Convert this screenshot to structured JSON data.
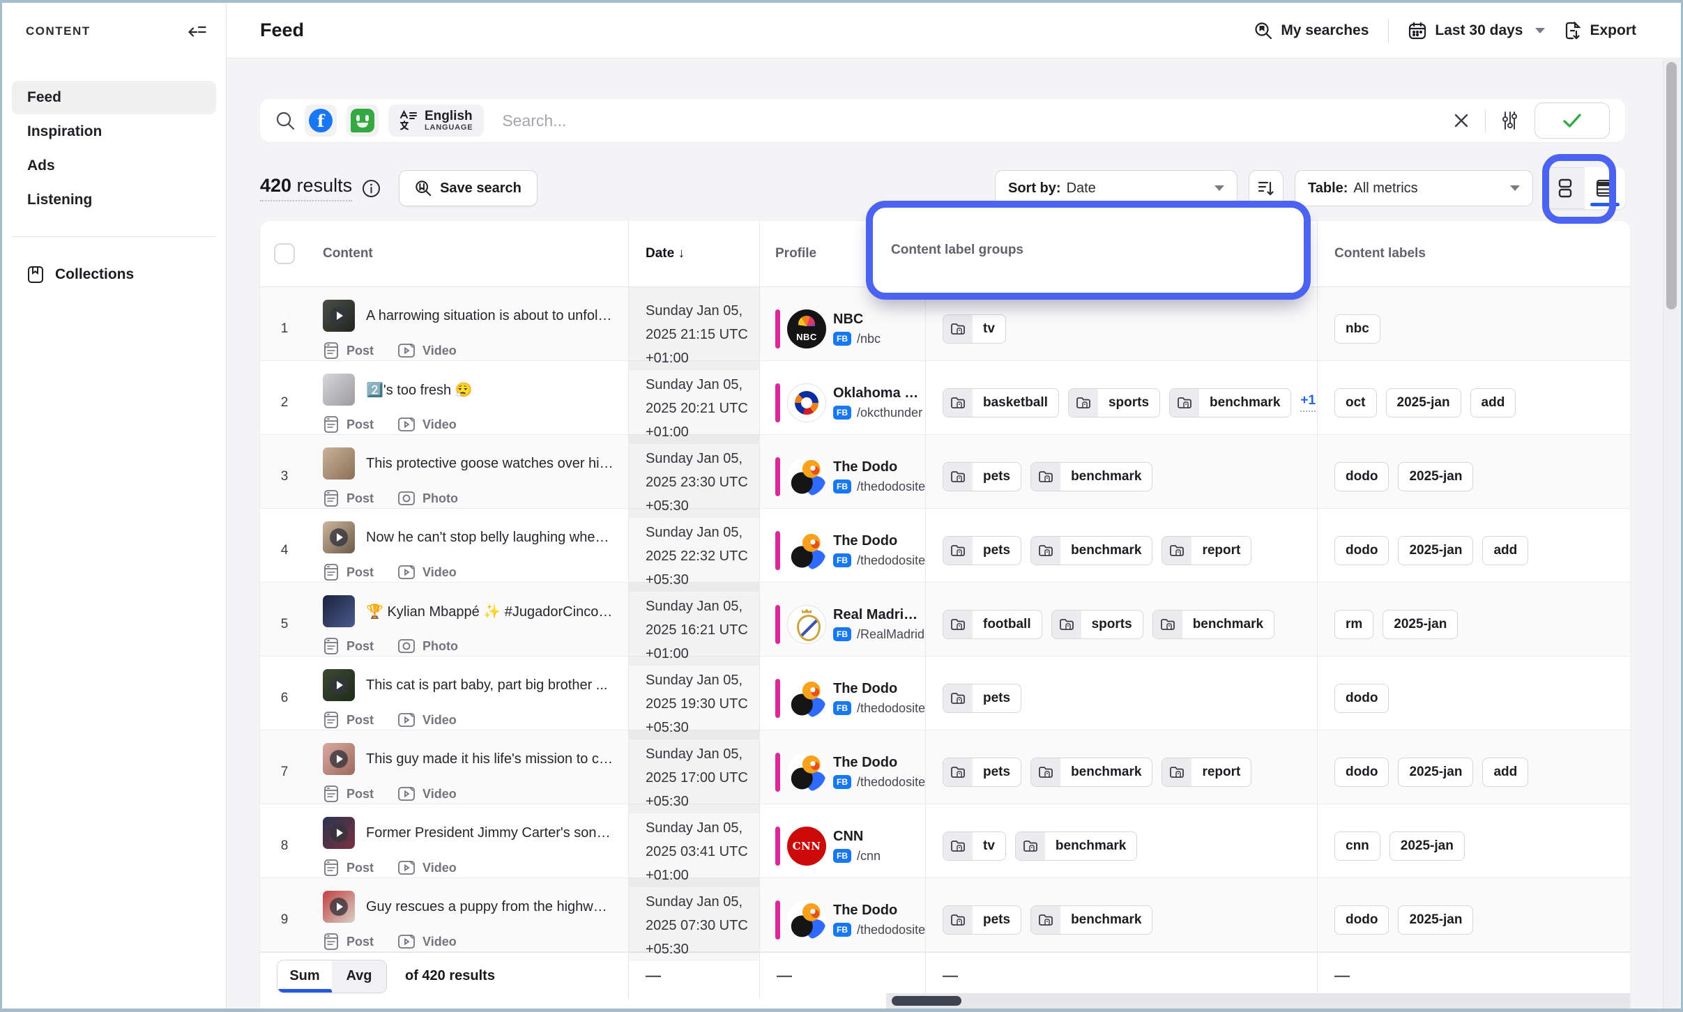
{
  "colors": {
    "accent_annotation": "#4b63f0",
    "facebook_blue": "#1877f2",
    "sentiment_green": "#35a843",
    "profile_bar_magenta": "#da2a97",
    "active_underline_blue": "#2b5ce6",
    "check_green": "#2fae47",
    "link_blue": "#2763e9"
  },
  "sidebar": {
    "section_label": "CONTENT",
    "items": [
      {
        "label": "Feed",
        "active": true
      },
      {
        "label": "Inspiration",
        "active": false
      },
      {
        "label": "Ads",
        "active": false
      },
      {
        "label": "Listening",
        "active": false
      }
    ],
    "collections_label": "Collections"
  },
  "topbar": {
    "title": "Feed",
    "my_searches_label": "My searches",
    "date_range_label": "Last 30 days",
    "export_label": "Export"
  },
  "search": {
    "placeholder": "Search...",
    "language_primary": "English",
    "language_secondary": "LANGUAGE",
    "filter_icons": [
      "facebook-filter",
      "sentiment-filter",
      "language-filter"
    ]
  },
  "toolbar": {
    "results_count": "420",
    "results_word": " results",
    "save_search_label": "Save search",
    "sort_label": "Sort by:",
    "sort_value": "Date",
    "table_label": "Table:",
    "table_value": "All metrics"
  },
  "table": {
    "headers": {
      "content": "Content",
      "date": "Date",
      "date_sort_arrow": "↓",
      "profile": "Profile",
      "label_groups": "Content label groups",
      "labels": "Content labels"
    },
    "rows": [
      {
        "num": "1",
        "title": "A harrowing situation is about to unfold....",
        "types": [
          "Post",
          "Video"
        ],
        "play": true,
        "date_lines": [
          "Sunday Jan 05,",
          "2025 21:15 UTC",
          "+01:00"
        ],
        "profile": {
          "name": "NBC",
          "network": "FB",
          "handle": "/nbc",
          "brand": "nbc",
          "avatar_text": "NBC"
        },
        "groups": [
          "tv"
        ],
        "groups_more": "",
        "labels": [
          "nbc"
        ],
        "thumb": [
          "#4a4f45",
          "#22251f"
        ]
      },
      {
        "num": "2",
        "title": "2️⃣'s too fresh 😮‍💨",
        "types": [
          "Post",
          "Video"
        ],
        "play": false,
        "date_lines": [
          "Sunday Jan 05,",
          "2025 20:21 UTC",
          "+01:00"
        ],
        "profile": {
          "name": "Oklahoma City Th...",
          "network": "FB",
          "handle": "/okcthunder",
          "brand": "okc",
          "avatar_text": ""
        },
        "groups": [
          "basketball",
          "sports",
          "benchmark"
        ],
        "groups_more": "+1",
        "labels": [
          "oct",
          "2025-jan",
          "add"
        ],
        "thumb": [
          "#d8d8da",
          "#9a9aa0"
        ]
      },
      {
        "num": "3",
        "title": "This protective goose watches over his ...",
        "types": [
          "Post",
          "Photo"
        ],
        "play": false,
        "date_lines": [
          "Sunday Jan 05,",
          "2025 23:30 UTC",
          "+05:30"
        ],
        "profile": {
          "name": "The Dodo",
          "network": "FB",
          "handle": "/thedodosite",
          "brand": "dodo",
          "avatar_text": ""
        },
        "groups": [
          "pets",
          "benchmark"
        ],
        "groups_more": "",
        "labels": [
          "dodo",
          "2025-jan"
        ],
        "thumb": [
          "#c9b39a",
          "#8a6f54"
        ]
      },
      {
        "num": "4",
        "title": "Now he can't stop belly laughing when ...",
        "types": [
          "Post",
          "Video"
        ],
        "play": true,
        "date_lines": [
          "Sunday Jan 05,",
          "2025 22:32 UTC",
          "+05:30"
        ],
        "profile": {
          "name": "The Dodo",
          "network": "FB",
          "handle": "/thedodosite",
          "brand": "dodo",
          "avatar_text": ""
        },
        "groups": [
          "pets",
          "benchmark",
          "report"
        ],
        "groups_more": "",
        "labels": [
          "dodo",
          "2025-jan",
          "add"
        ],
        "thumb": [
          "#cdb49c",
          "#6b5b49"
        ]
      },
      {
        "num": "5",
        "title": "🏆 Kylian Mbappé ✨ #JugadorCincoEst...",
        "types": [
          "Post",
          "Photo"
        ],
        "play": false,
        "date_lines": [
          "Sunday Jan 05,",
          "2025 16:21 UTC",
          "+01:00"
        ],
        "profile": {
          "name": "Real Madrid C.F.",
          "network": "FB",
          "handle": "/RealMadrid",
          "brand": "rm",
          "avatar_text": ""
        },
        "groups": [
          "football",
          "sports",
          "benchmark"
        ],
        "groups_more": "",
        "labels": [
          "rm",
          "2025-jan"
        ],
        "thumb": [
          "#1c2340",
          "#4a5a8a"
        ]
      },
      {
        "num": "6",
        "title": "This cat is part baby, part big brother ...",
        "types": [
          "Post",
          "Video"
        ],
        "play": true,
        "date_lines": [
          "Sunday Jan 05,",
          "2025 19:30 UTC",
          "+05:30"
        ],
        "profile": {
          "name": "The Dodo",
          "network": "FB",
          "handle": "/thedodosite",
          "brand": "dodo",
          "avatar_text": ""
        },
        "groups": [
          "pets"
        ],
        "groups_more": "",
        "labels": [
          "dodo"
        ],
        "thumb": [
          "#3c4a33",
          "#1f2a1a"
        ]
      },
      {
        "num": "7",
        "title": "This guy made it his life's mission to cle...",
        "types": [
          "Post",
          "Video"
        ],
        "play": true,
        "date_lines": [
          "Sunday Jan 05,",
          "2025 17:00 UTC",
          "+05:30"
        ],
        "profile": {
          "name": "The Dodo",
          "network": "FB",
          "handle": "/thedodosite",
          "brand": "dodo",
          "avatar_text": ""
        },
        "groups": [
          "pets",
          "benchmark",
          "report"
        ],
        "groups_more": "",
        "labels": [
          "dodo",
          "2025-jan",
          "add"
        ],
        "thumb": [
          "#d8a9a0",
          "#a06a5f"
        ]
      },
      {
        "num": "8",
        "title": "Former President Jimmy Carter's son C...",
        "types": [
          "Post",
          "Video"
        ],
        "play": true,
        "date_lines": [
          "Sunday Jan 05,",
          "2025 03:41 UTC",
          "+01:00"
        ],
        "profile": {
          "name": "CNN",
          "network": "FB",
          "handle": "/cnn",
          "brand": "cnn",
          "avatar_text": "CNN"
        },
        "groups": [
          "tv",
          "benchmark"
        ],
        "groups_more": "",
        "labels": [
          "cnn",
          "2025-jan"
        ],
        "thumb": [
          "#2a3550",
          "#7a3040"
        ]
      },
      {
        "num": "9",
        "title": "Guy rescues a puppy from the highway ...",
        "types": [
          "Post",
          "Video"
        ],
        "play": true,
        "date_lines": [
          "Sunday Jan 05,",
          "2025 07:30 UTC",
          "+05:30"
        ],
        "profile": {
          "name": "The Dodo",
          "network": "FB",
          "handle": "/thedodosite",
          "brand": "dodo",
          "avatar_text": ""
        },
        "groups": [
          "pets",
          "benchmark"
        ],
        "groups_more": "",
        "labels": [
          "dodo",
          "2025-jan"
        ],
        "thumb": [
          "#c24040",
          "#d8d0c8"
        ]
      }
    ]
  },
  "footer": {
    "sum_label": "Sum",
    "avg_label": "Avg",
    "of_label": "of 420 results",
    "empty_value": "—"
  },
  "annotation": {
    "label_groups_text": "Content label groups"
  }
}
